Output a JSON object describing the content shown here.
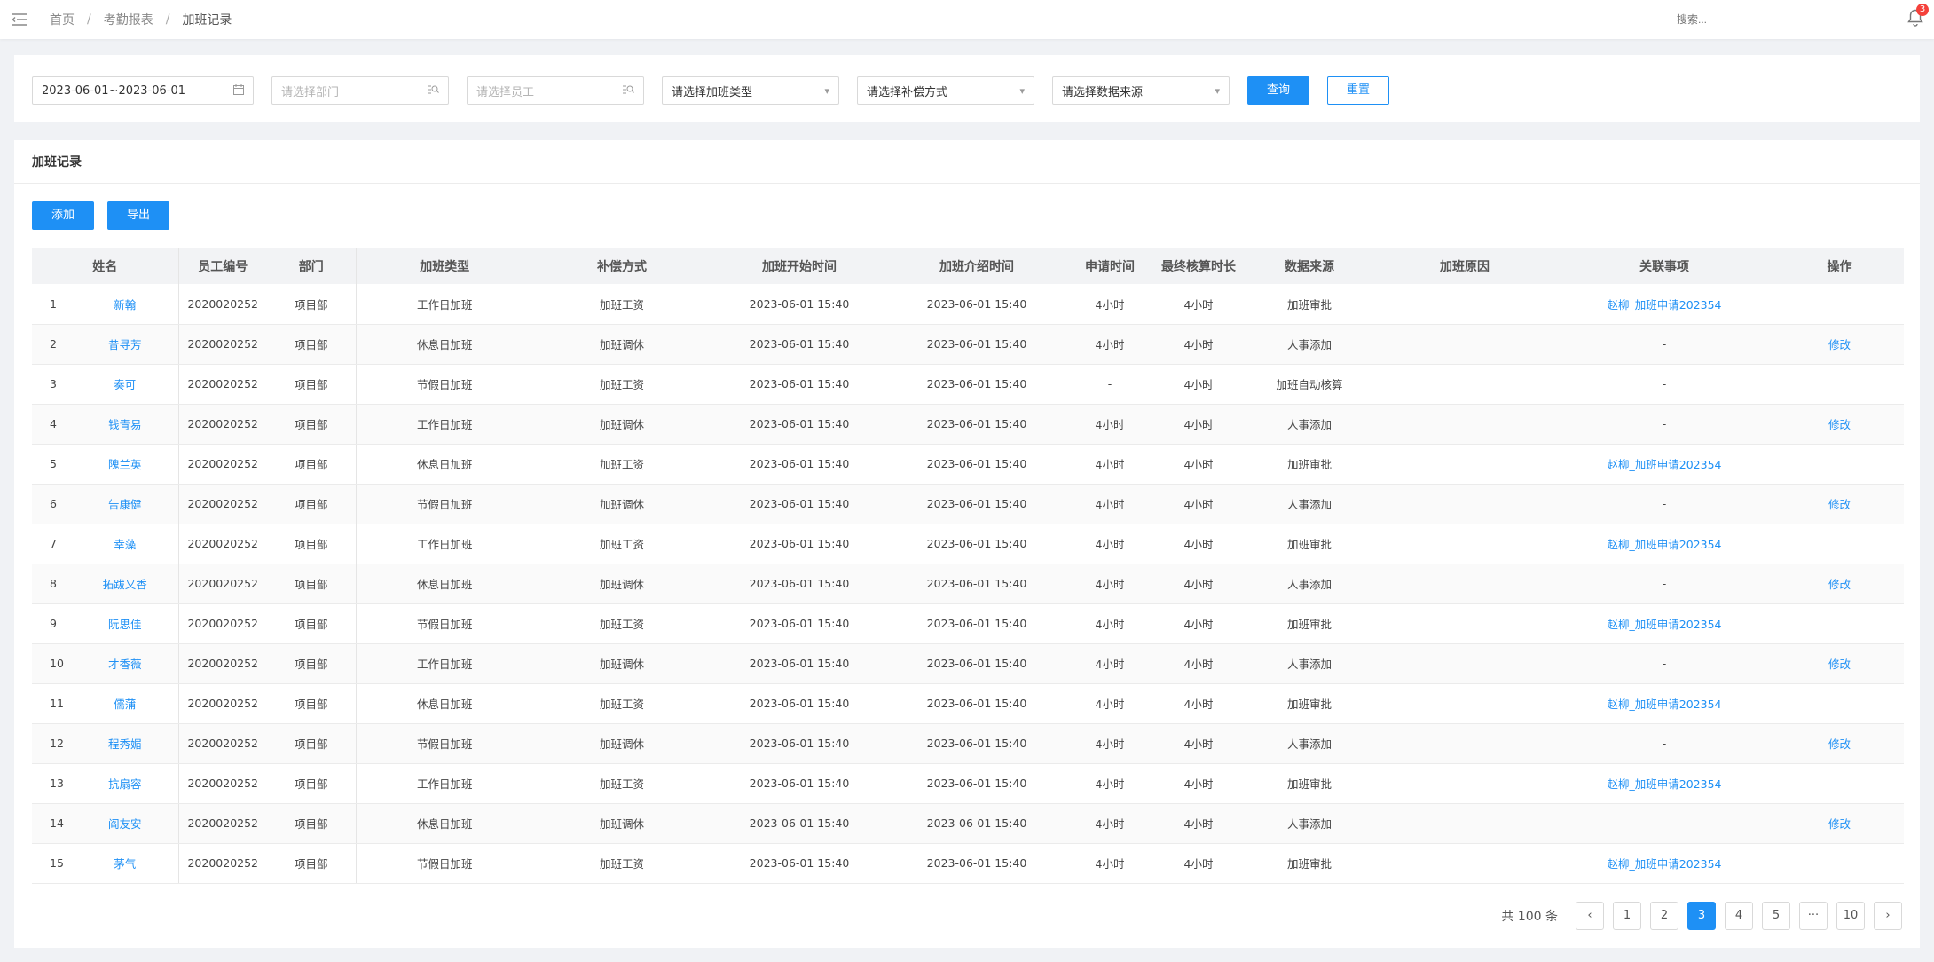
{
  "header": {
    "breadcrumb": [
      "首页",
      "考勤报表",
      "加班记录"
    ],
    "search_placeholder": "搜索...",
    "notification_count": "3"
  },
  "filters": {
    "date_range": "2023-06-01~2023-06-01",
    "department_placeholder": "请选择部门",
    "employee_placeholder": "请选择员工",
    "overtime_type_placeholder": "请选择加班类型",
    "compensation_placeholder": "请选择补偿方式",
    "data_source_placeholder": "请选择数据来源",
    "query_label": "查询",
    "reset_label": "重置"
  },
  "card": {
    "title": "加班记录",
    "add_label": "添加",
    "export_label": "导出"
  },
  "table": {
    "columns": [
      "姓名",
      "员工编号",
      "部门",
      "加班类型",
      "补偿方式",
      "加班开始时间",
      "加班介绍时间",
      "申请时间",
      "最终核算时长",
      "数据来源",
      "加班原因",
      "关联事项",
      "操作"
    ],
    "rows": [
      {
        "no": "1",
        "name": "新翰",
        "id": "2020020252",
        "dept": "项目部",
        "type": "工作日加班",
        "comp": "加班工资",
        "start": "2023-06-01 15:40",
        "end": "2023-06-01 15:40",
        "apply": "4小时",
        "final": "4小时",
        "source": "加班审批",
        "reason": "",
        "related": "赵柳_加班申请202354",
        "action": ""
      },
      {
        "no": "2",
        "name": "昔寻芳",
        "id": "2020020252",
        "dept": "项目部",
        "type": "休息日加班",
        "comp": "加班调休",
        "start": "2023-06-01 15:40",
        "end": "2023-06-01 15:40",
        "apply": "4小时",
        "final": "4小时",
        "source": "人事添加",
        "reason": "",
        "related": "-",
        "action": "修改"
      },
      {
        "no": "3",
        "name": "奏可",
        "id": "2020020252",
        "dept": "项目部",
        "type": "节假日加班",
        "comp": "加班工资",
        "start": "2023-06-01 15:40",
        "end": "2023-06-01 15:40",
        "apply": "-",
        "final": "4小时",
        "source": "加班自动核算",
        "reason": "",
        "related": "-",
        "action": ""
      },
      {
        "no": "4",
        "name": "钱青易",
        "id": "2020020252",
        "dept": "项目部",
        "type": "工作日加班",
        "comp": "加班调休",
        "start": "2023-06-01 15:40",
        "end": "2023-06-01 15:40",
        "apply": "4小时",
        "final": "4小时",
        "source": "人事添加",
        "reason": "",
        "related": "-",
        "action": "修改"
      },
      {
        "no": "5",
        "name": "隗兰英",
        "id": "2020020252",
        "dept": "项目部",
        "type": "休息日加班",
        "comp": "加班工资",
        "start": "2023-06-01 15:40",
        "end": "2023-06-01 15:40",
        "apply": "4小时",
        "final": "4小时",
        "source": "加班审批",
        "reason": "",
        "related": "赵柳_加班申请202354",
        "action": ""
      },
      {
        "no": "6",
        "name": "告康健",
        "id": "2020020252",
        "dept": "项目部",
        "type": "节假日加班",
        "comp": "加班调休",
        "start": "2023-06-01 15:40",
        "end": "2023-06-01 15:40",
        "apply": "4小时",
        "final": "4小时",
        "source": "人事添加",
        "reason": "",
        "related": "-",
        "action": "修改"
      },
      {
        "no": "7",
        "name": "幸藻",
        "id": "2020020252",
        "dept": "项目部",
        "type": "工作日加班",
        "comp": "加班工资",
        "start": "2023-06-01 15:40",
        "end": "2023-06-01 15:40",
        "apply": "4小时",
        "final": "4小时",
        "source": "加班审批",
        "reason": "",
        "related": "赵柳_加班申请202354",
        "action": ""
      },
      {
        "no": "8",
        "name": "拓跋又香",
        "id": "2020020252",
        "dept": "项目部",
        "type": "休息日加班",
        "comp": "加班调休",
        "start": "2023-06-01 15:40",
        "end": "2023-06-01 15:40",
        "apply": "4小时",
        "final": "4小时",
        "source": "人事添加",
        "reason": "",
        "related": "-",
        "action": "修改"
      },
      {
        "no": "9",
        "name": "阮思佳",
        "id": "2020020252",
        "dept": "项目部",
        "type": "节假日加班",
        "comp": "加班工资",
        "start": "2023-06-01 15:40",
        "end": "2023-06-01 15:40",
        "apply": "4小时",
        "final": "4小时",
        "source": "加班审批",
        "reason": "",
        "related": "赵柳_加班申请202354",
        "action": ""
      },
      {
        "no": "10",
        "name": "才香薇",
        "id": "2020020252",
        "dept": "项目部",
        "type": "工作日加班",
        "comp": "加班调休",
        "start": "2023-06-01 15:40",
        "end": "2023-06-01 15:40",
        "apply": "4小时",
        "final": "4小时",
        "source": "人事添加",
        "reason": "",
        "related": "-",
        "action": "修改"
      },
      {
        "no": "11",
        "name": "儒蒲",
        "id": "2020020252",
        "dept": "项目部",
        "type": "休息日加班",
        "comp": "加班工资",
        "start": "2023-06-01 15:40",
        "end": "2023-06-01 15:40",
        "apply": "4小时",
        "final": "4小时",
        "source": "加班审批",
        "reason": "",
        "related": "赵柳_加班申请202354",
        "action": ""
      },
      {
        "no": "12",
        "name": "程秀媚",
        "id": "2020020252",
        "dept": "项目部",
        "type": "节假日加班",
        "comp": "加班调休",
        "start": "2023-06-01 15:40",
        "end": "2023-06-01 15:40",
        "apply": "4小时",
        "final": "4小时",
        "source": "人事添加",
        "reason": "",
        "related": "-",
        "action": "修改"
      },
      {
        "no": "13",
        "name": "抗扇容",
        "id": "2020020252",
        "dept": "项目部",
        "type": "工作日加班",
        "comp": "加班工资",
        "start": "2023-06-01 15:40",
        "end": "2023-06-01 15:40",
        "apply": "4小时",
        "final": "4小时",
        "source": "加班审批",
        "reason": "",
        "related": "赵柳_加班申请202354",
        "action": ""
      },
      {
        "no": "14",
        "name": "阎友安",
        "id": "2020020252",
        "dept": "项目部",
        "type": "休息日加班",
        "comp": "加班调休",
        "start": "2023-06-01 15:40",
        "end": "2023-06-01 15:40",
        "apply": "4小时",
        "final": "4小时",
        "source": "人事添加",
        "reason": "",
        "related": "-",
        "action": "修改"
      },
      {
        "no": "15",
        "name": "茅气",
        "id": "2020020252",
        "dept": "项目部",
        "type": "节假日加班",
        "comp": "加班工资",
        "start": "2023-06-01 15:40",
        "end": "2023-06-01 15:40",
        "apply": "4小时",
        "final": "4小时",
        "source": "加班审批",
        "reason": "",
        "related": "赵柳_加班申请202354",
        "action": ""
      }
    ]
  },
  "pagination": {
    "total_text": "共 100 条",
    "prev_icon": "chevron-left-icon",
    "next_icon": "chevron-right-icon",
    "pages": [
      "1",
      "2",
      "3",
      "4",
      "5",
      "···",
      "10"
    ],
    "current": "3"
  },
  "colors": {
    "primary": "#1e90f5",
    "badge": "#f5413b"
  }
}
